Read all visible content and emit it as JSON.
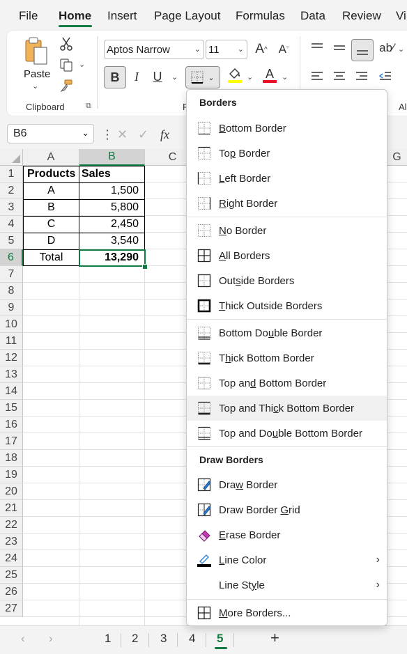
{
  "tabs": [
    "File",
    "Home",
    "Insert",
    "Page Layout",
    "Formulas",
    "Data",
    "Review",
    "Vi"
  ],
  "ribbon": {
    "paste_label": "Paste",
    "clipboard_label": "Clipboard",
    "font_name": "Aptos Narrow",
    "font_size": "11",
    "bold": "B",
    "italic": "I",
    "underline": "U",
    "font_group_clip": "F",
    "align_group_clip": "Al"
  },
  "formula_bar": {
    "name_box": "B6",
    "fx": "fx"
  },
  "sheet": {
    "columns": [
      "A",
      "B",
      "C",
      "",
      "",
      "",
      "G"
    ],
    "rows": [
      "1",
      "2",
      "3",
      "4",
      "5",
      "6",
      "7",
      "8",
      "9",
      "10",
      "11",
      "12",
      "13",
      "14",
      "15",
      "16",
      "17",
      "18",
      "19",
      "20",
      "21",
      "22",
      "23",
      "24",
      "25",
      "26",
      "27"
    ],
    "table": {
      "headers": [
        "Products",
        "Sales"
      ],
      "data": [
        [
          "A",
          "1,500"
        ],
        [
          "B",
          "5,800"
        ],
        [
          "C",
          "2,450"
        ],
        [
          "D",
          "3,540"
        ]
      ],
      "total": [
        "Total",
        "13,290"
      ]
    }
  },
  "sheet_tabs": [
    "1",
    "2",
    "3",
    "4",
    "5"
  ],
  "add_sheet": "+",
  "border_menu": {
    "title": "Borders",
    "items": [
      {
        "pre": "",
        "u": "B",
        "post": "ottom Border",
        "icon": "bottom-border-icon"
      },
      {
        "pre": "To",
        "u": "p",
        "post": " Border",
        "icon": "top-border-icon"
      },
      {
        "pre": "",
        "u": "L",
        "post": "eft Border",
        "icon": "left-border-icon"
      },
      {
        "pre": "",
        "u": "R",
        "post": "ight Border",
        "icon": "right-border-icon"
      },
      {
        "pre": "",
        "u": "N",
        "post": "o Border",
        "icon": "no-border-icon"
      },
      {
        "pre": "",
        "u": "A",
        "post": "ll Borders",
        "icon": "all-borders-icon"
      },
      {
        "pre": "Out",
        "u": "s",
        "post": "ide Borders",
        "icon": "outside-borders-icon"
      },
      {
        "pre": "",
        "u": "T",
        "post": "hick Outside Borders",
        "icon": "thick-outside-borders-icon"
      },
      {
        "pre": "Bottom Do",
        "u": "u",
        "post": "ble Border",
        "icon": "bottom-double-border-icon"
      },
      {
        "pre": "T",
        "u": "h",
        "post": "ick Bottom Border",
        "icon": "thick-bottom-border-icon"
      },
      {
        "pre": "Top an",
        "u": "d",
        "post": " Bottom Border",
        "icon": "top-and-bottom-border-icon"
      },
      {
        "pre": "Top and Thi",
        "u": "c",
        "post": "k Bottom Border",
        "icon": "top-thick-bottom-border-icon"
      },
      {
        "pre": "Top and Do",
        "u": "u",
        "post": "ble Bottom Border",
        "icon": "top-double-bottom-border-icon"
      }
    ],
    "draw_title": "Draw Borders",
    "draw_items": [
      {
        "pre": "Dra",
        "u": "w",
        "post": " Border",
        "icon": "draw-border-icon"
      },
      {
        "pre": "Draw Border ",
        "u": "G",
        "post": "rid",
        "icon": "draw-border-grid-icon"
      },
      {
        "pre": "",
        "u": "E",
        "post": "rase Border",
        "icon": "erase-border-icon"
      },
      {
        "pre": "",
        "u": "L",
        "post": "ine Color",
        "icon": "line-color-icon",
        "submenu": "›"
      },
      {
        "pre": "Line St",
        "u": "y",
        "post": "le",
        "icon": "line-style-icon",
        "submenu": "›"
      }
    ],
    "more": {
      "pre": "",
      "u": "M",
      "post": "ore Borders...",
      "icon": "more-borders-icon"
    }
  },
  "colors": {
    "accent": "#107c41",
    "highlight": "#ffff00",
    "font_red": "#e81123"
  }
}
